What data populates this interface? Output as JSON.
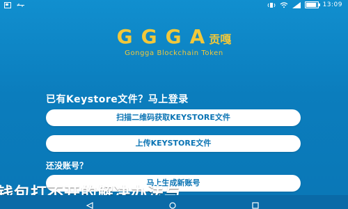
{
  "statusbar": {
    "left_icons": [
      "sim-icon",
      "usb-icon"
    ],
    "time": "13:09",
    "battery_fraction": 0.9
  },
  "brand": {
    "logo_letters": "GGGA",
    "logo_cn": "贡嘎",
    "subtitle": "Gongga Blockchain Token"
  },
  "keystore": {
    "title": "已有Keystore文件？马上登录",
    "scan_label": "扫描二维码获取KEYSTORE文件",
    "upload_label": "上传KEYSTORE文件"
  },
  "no_account": {
    "title": "还没账号？",
    "create_label": "马上生成新账号"
  },
  "watermark": "钱包打不开的解决办法与",
  "navbar": {
    "back_icon": "back-icon",
    "home_icon": "home-icon",
    "recent_icon": "recent-apps-icon"
  }
}
